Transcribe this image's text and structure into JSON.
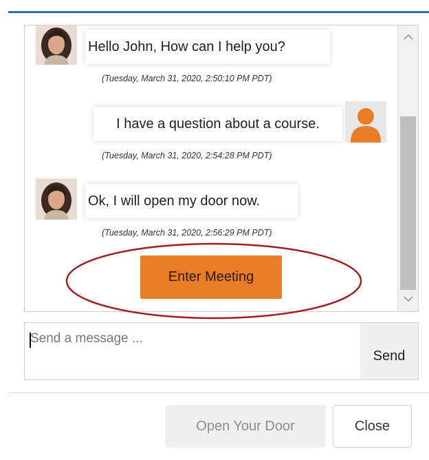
{
  "chat": {
    "messages": [
      {
        "sender": "agent",
        "avatar_icon": "woman-avatar-photo",
        "text": "Hello John, How can I help you?",
        "timestamp": "(Tuesday, March 31, 2020, 2:50:10 PM PDT)"
      },
      {
        "sender": "user",
        "avatar_icon": "user-silhouette-icon",
        "text": "I have a question about a course.",
        "timestamp": "(Tuesday, March 31, 2020, 2:54:28 PM PDT)"
      },
      {
        "sender": "agent",
        "avatar_icon": "woman-avatar-photo",
        "text": "Ok, I will open my door now.",
        "timestamp": "(Tuesday, March 31, 2020, 2:56:29 PM PDT)"
      }
    ],
    "enter_meeting_label": "Enter Meeting",
    "scroll_up_icon": "chevron-up-icon",
    "scroll_down_icon": "chevron-down-icon"
  },
  "composer": {
    "placeholder": "Send a message ...",
    "value": "",
    "send_label": "Send"
  },
  "footer": {
    "open_door_label": "Open Your Door",
    "close_label": "Close"
  },
  "colors": {
    "accent_rule": "#2f6fa7",
    "enter_button": "#e87d26",
    "highlight_ellipse": "#a11d22",
    "user_avatar": "#e87d26"
  }
}
